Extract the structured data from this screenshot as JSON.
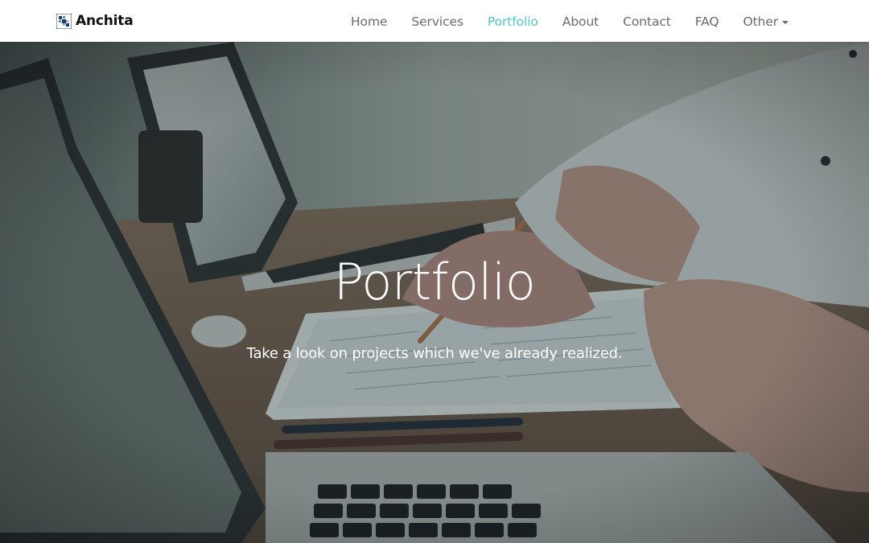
{
  "brand": {
    "name": "Anchita",
    "logo_icon": "pixel-grid-logo"
  },
  "nav": {
    "items": [
      {
        "label": "Home",
        "active": false
      },
      {
        "label": "Services",
        "active": false
      },
      {
        "label": "Portfolio",
        "active": true
      },
      {
        "label": "About",
        "active": false
      },
      {
        "label": "Contact",
        "active": false
      },
      {
        "label": "FAQ",
        "active": false
      },
      {
        "label": "Other",
        "active": false,
        "dropdown": true
      }
    ]
  },
  "hero": {
    "title": "Portfolio",
    "subtitle": "Take a look on projects which we've already realized.",
    "background": "office desk with laptops, pens and sketches"
  },
  "colors": {
    "accent": "#4fc9c1",
    "nav_text": "#6b6b6b",
    "brand_text": "#111111"
  }
}
